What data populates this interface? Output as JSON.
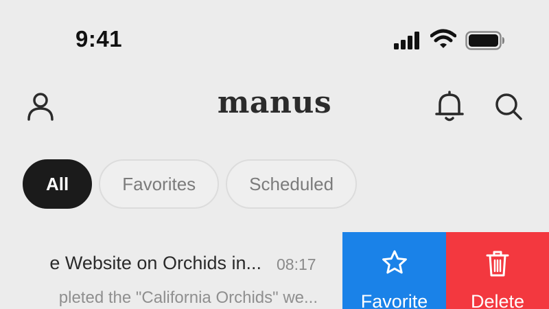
{
  "status_bar": {
    "time": "9:41",
    "icons": [
      "cellular-signal-icon",
      "wifi-icon",
      "battery-icon"
    ]
  },
  "header": {
    "logo": "manus",
    "icons": [
      "user-profile-icon",
      "bell-icon",
      "search-icon"
    ]
  },
  "filters": {
    "tabs": [
      {
        "label": "All",
        "active": true
      },
      {
        "label": "Favorites",
        "active": false
      },
      {
        "label": "Scheduled",
        "active": false
      }
    ]
  },
  "tasks": [
    {
      "title": "e Website on Orchids in...",
      "time": "08:17",
      "preview": "pleted the \"California Orchids\" we...",
      "actions": {
        "favorite": {
          "label": "Favorite",
          "icon": "star-icon",
          "color": "#1a82e8"
        },
        "delete": {
          "label": "Delete",
          "icon": "trash-icon",
          "color": "#f3383f"
        }
      }
    }
  ],
  "colors": {
    "background": "#ececec",
    "active_tab": "#1b1b1b",
    "favorite": "#1a82e8",
    "delete": "#f3383f"
  }
}
